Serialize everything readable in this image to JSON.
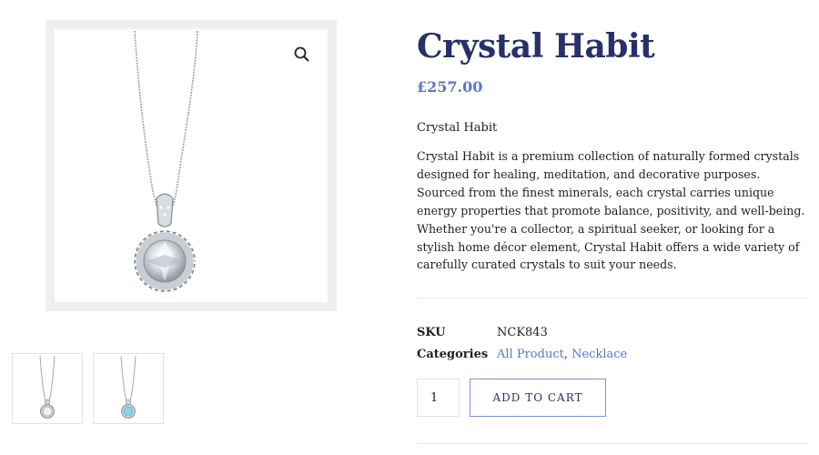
{
  "product": {
    "title": "Crystal Habit",
    "price": "£257.00",
    "short_title": "Crystal Habit",
    "description": "Crystal Habit is a premium collection of naturally formed crystals designed for healing, meditation, and decorative purposes. Sourced from the finest minerals, each crystal carries unique energy properties that promote balance, positivity, and well-being. Whether you're a collector, a spiritual seeker, or looking for a stylish home décor element, Crystal Habit offers a wide variety of carefully curated crystals to suit your needs."
  },
  "meta": {
    "sku_label": "SKU",
    "sku_value": "NCK843",
    "categories_label": "Categories",
    "categories": [
      "All Product",
      "Necklace"
    ],
    "separator": ", "
  },
  "cart": {
    "quantity": "1",
    "add_label": "ADD TO CART"
  },
  "gallery": {
    "zoom_icon": "search-icon",
    "thumbnails": [
      "diamond-pendant-thumbnail",
      "aquamarine-pendant-thumbnail"
    ]
  },
  "colors": {
    "title": "#27306a",
    "accent": "#5a76c4",
    "button_border": "#7d93d6"
  }
}
